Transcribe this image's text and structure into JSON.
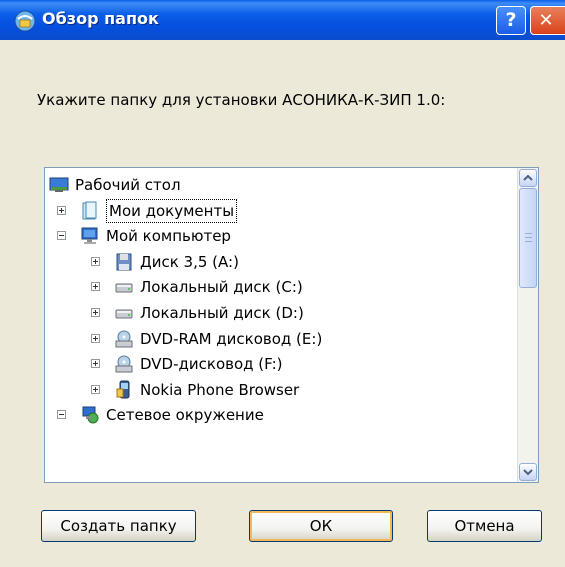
{
  "window": {
    "title": "Обзор папок",
    "help_label": "?",
    "close_label": "✕"
  },
  "prompt": "Укажите папку для установки АСОНИКА-К-ЗИП 1.0:",
  "tree": {
    "items": [
      {
        "label": "Рабочий стол",
        "icon": "desktop-icon",
        "level": 0,
        "expander": "none",
        "selected": false
      },
      {
        "label": "Мои документы",
        "icon": "my-documents-icon",
        "level": 1,
        "expander": "plus",
        "selected": true
      },
      {
        "label": "Мой компьютер",
        "icon": "my-computer-icon",
        "level": 1,
        "expander": "minus",
        "selected": false
      },
      {
        "label": "Диск 3,5 (A:)",
        "icon": "floppy-drive-icon",
        "level": 2,
        "expander": "plus",
        "selected": false
      },
      {
        "label": "Локальный диск (C:)",
        "icon": "hard-drive-icon",
        "level": 2,
        "expander": "plus",
        "selected": false
      },
      {
        "label": "Локальный диск (D:)",
        "icon": "hard-drive-icon",
        "level": 2,
        "expander": "plus",
        "selected": false
      },
      {
        "label": "DVD-RAM дисковод (E:)",
        "icon": "dvd-drive-icon",
        "level": 2,
        "expander": "plus",
        "selected": false
      },
      {
        "label": "DVD-дисковод (F:)",
        "icon": "dvd-drive-icon",
        "level": 2,
        "expander": "plus",
        "selected": false
      },
      {
        "label": "Nokia Phone Browser",
        "icon": "phone-browser-icon",
        "level": 2,
        "expander": "plus",
        "selected": false
      },
      {
        "label": "Сетевое окружение",
        "icon": "network-icon",
        "level": 1,
        "expander": "minus",
        "selected": false
      }
    ]
  },
  "buttons": {
    "new_folder": "Создать папку",
    "ok": "ОК",
    "cancel": "Отмена"
  }
}
